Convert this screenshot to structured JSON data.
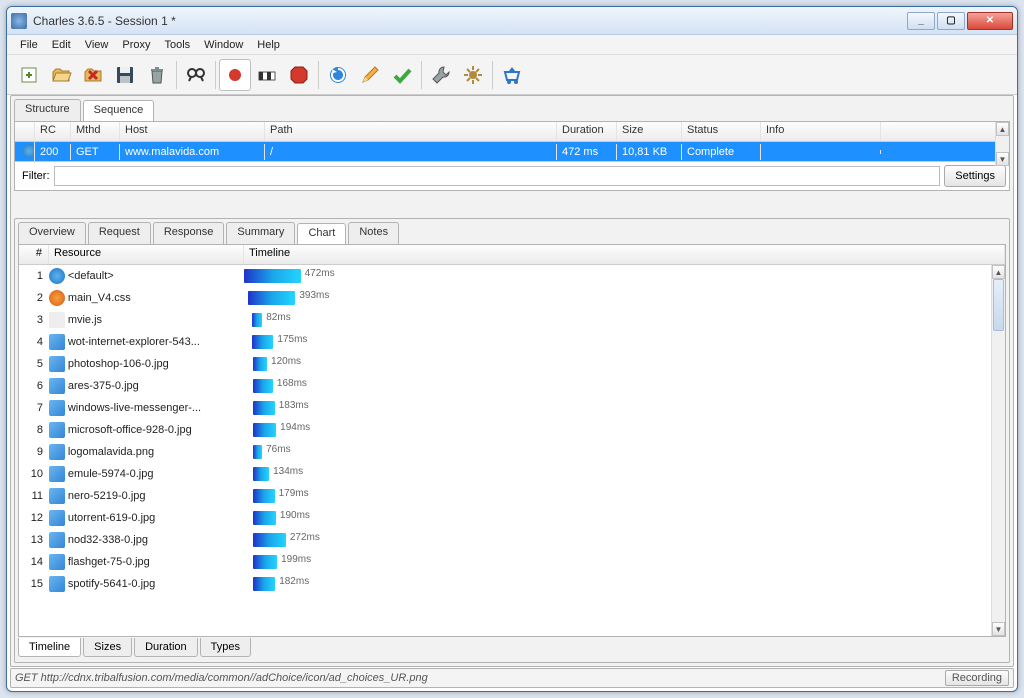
{
  "window": {
    "title": "Charles 3.6.5 - Session 1 *"
  },
  "menu": [
    "File",
    "Edit",
    "View",
    "Proxy",
    "Tools",
    "Window",
    "Help"
  ],
  "toolbar_icons": [
    "new-session",
    "open",
    "close",
    "save",
    "trash",
    "find",
    "record",
    "throttle",
    "stop",
    "refresh",
    "edit",
    "validate",
    "tools",
    "settings",
    "publish"
  ],
  "main_tabs": [
    "Structure",
    "Sequence"
  ],
  "main_tab_active": 1,
  "columns": [
    "",
    "RC",
    "Mthd",
    "Host",
    "Path",
    "Duration",
    "Size",
    "Status",
    "Info"
  ],
  "request_row": {
    "rc": "200",
    "method": "GET",
    "host": "www.malavida.com",
    "path": "/",
    "duration": "472 ms",
    "size": "10,81 KB",
    "status": "Complete",
    "info": ""
  },
  "filter": {
    "label": "Filter:",
    "value": "",
    "settings_label": "Settings"
  },
  "detail_tabs": [
    "Overview",
    "Request",
    "Response",
    "Summary",
    "Chart",
    "Notes"
  ],
  "detail_tab_active": 4,
  "chart_columns": [
    "#",
    "Resource",
    "Timeline"
  ],
  "chart_data": {
    "type": "bar",
    "xlabel": "Timeline",
    "series": [
      {
        "n": 1,
        "name": "<default>",
        "offset": 0,
        "dur": 472,
        "label": "472ms",
        "icon": "globe"
      },
      {
        "n": 2,
        "name": "main_V4.css",
        "offset": 35,
        "dur": 393,
        "label": "393ms",
        "icon": "firefox"
      },
      {
        "n": 3,
        "name": "mvie.js",
        "offset": 70,
        "dur": 82,
        "label": "82ms",
        "icon": "js"
      },
      {
        "n": 4,
        "name": "wot-internet-explorer-543...",
        "offset": 70,
        "dur": 175,
        "label": "175ms",
        "icon": "img"
      },
      {
        "n": 5,
        "name": "photoshop-106-0.jpg",
        "offset": 72,
        "dur": 120,
        "label": "120ms",
        "icon": "img"
      },
      {
        "n": 6,
        "name": "ares-375-0.jpg",
        "offset": 73,
        "dur": 168,
        "label": "168ms",
        "icon": "img"
      },
      {
        "n": 7,
        "name": "windows-live-messenger-...",
        "offset": 73,
        "dur": 183,
        "label": "183ms",
        "icon": "img"
      },
      {
        "n": 8,
        "name": "microsoft-office-928-0.jpg",
        "offset": 74,
        "dur": 194,
        "label": "194ms",
        "icon": "img"
      },
      {
        "n": 9,
        "name": "logomalavida.png",
        "offset": 75,
        "dur": 76,
        "label": "76ms",
        "icon": "img"
      },
      {
        "n": 10,
        "name": "emule-5974-0.jpg",
        "offset": 75,
        "dur": 134,
        "label": "134ms",
        "icon": "img"
      },
      {
        "n": 11,
        "name": "nero-5219-0.jpg",
        "offset": 76,
        "dur": 179,
        "label": "179ms",
        "icon": "img"
      },
      {
        "n": 12,
        "name": "utorrent-619-0.jpg",
        "offset": 76,
        "dur": 190,
        "label": "190ms",
        "icon": "img"
      },
      {
        "n": 13,
        "name": "nod32-338-0.jpg",
        "offset": 77,
        "dur": 272,
        "label": "272ms",
        "icon": "img"
      },
      {
        "n": 14,
        "name": "flashget-75-0.jpg",
        "offset": 77,
        "dur": 199,
        "label": "199ms",
        "icon": "img"
      },
      {
        "n": 15,
        "name": "spotify-5641-0.jpg",
        "offset": 78,
        "dur": 182,
        "label": "182ms",
        "icon": "img"
      }
    ],
    "max_time": 600
  },
  "bottom_tabs": [
    "Timeline",
    "Sizes",
    "Duration",
    "Types"
  ],
  "bottom_tab_active": 0,
  "status": {
    "text": "GET http://cdnx.tribalfusion.com/media/common//adChoice/icon/ad_choices_UR.png",
    "recording": "Recording"
  }
}
